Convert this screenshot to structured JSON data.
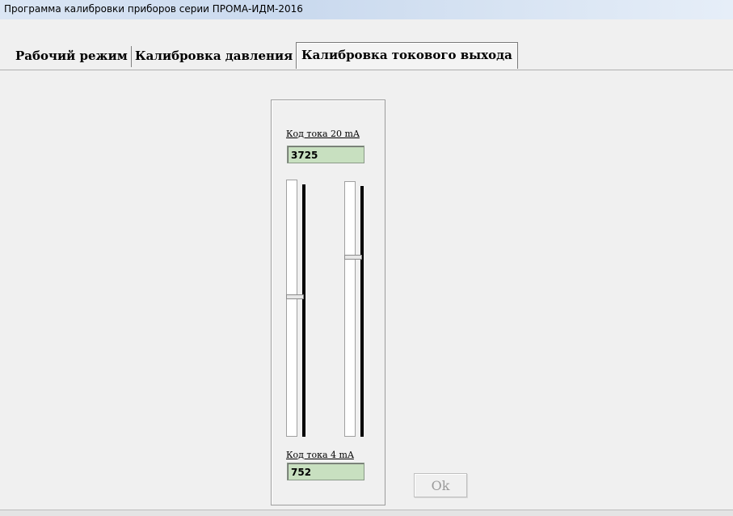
{
  "window": {
    "title": "Программа калибровки приборов серии ПРОМА-ИДМ-2016"
  },
  "tabs": [
    {
      "label": "Рабочий режим",
      "active": false
    },
    {
      "label": "Калибровка давления",
      "active": false
    },
    {
      "label": "Калибровка токового выхода",
      "active": true
    }
  ],
  "calibration": {
    "top_label": "Код тока 20 mA",
    "top_value": "3725",
    "bottom_label": "Код тока 4 mA",
    "bottom_value": "752"
  },
  "sliders": [
    {
      "name": "left",
      "level": 0.55
    },
    {
      "name": "right",
      "level": 0.71
    }
  ],
  "ok_button": {
    "label": "Ok",
    "enabled": false
  },
  "colors": {
    "field_bg": "#c8e0c0",
    "background": "#f0f0f0"
  }
}
